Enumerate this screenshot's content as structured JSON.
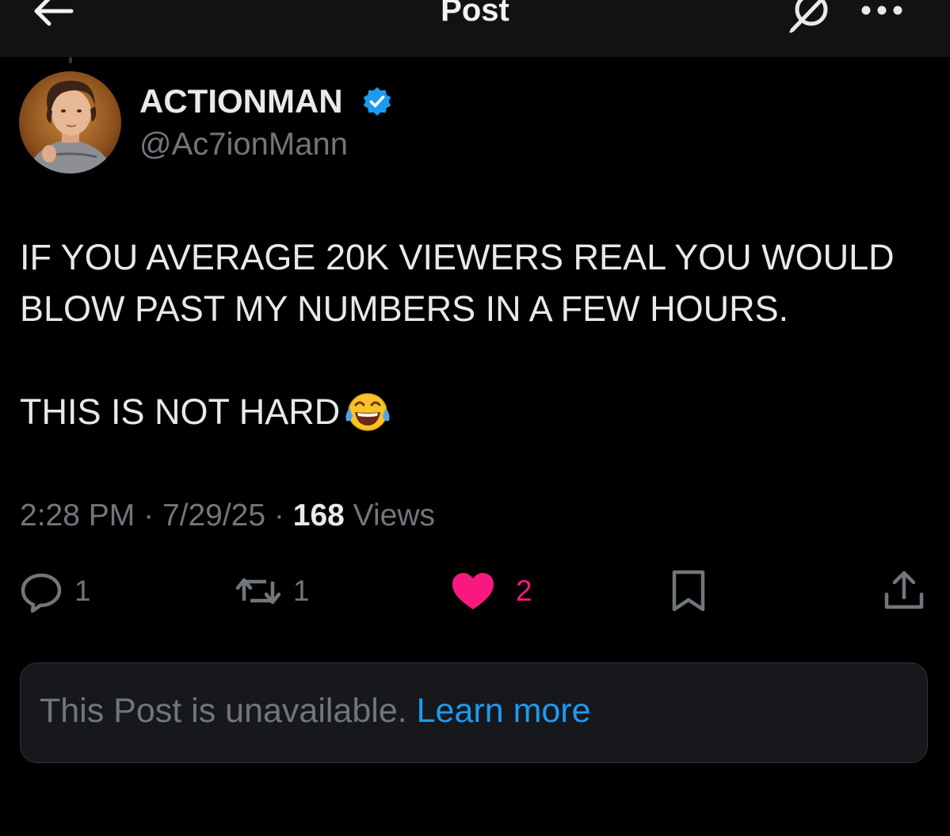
{
  "header": {
    "title": "Post",
    "back_icon": "arrow-left-icon",
    "grok_icon": "grok-icon",
    "more_icon": "more-horizontal-icon"
  },
  "author": {
    "name": "ACTIONMAN",
    "handle": "@Ac7ionMann",
    "verified": true,
    "verified_badge_color": "#1d9bf0"
  },
  "post": {
    "lines": [
      "IF YOU AVERAGE 20K VIEWERS REAL YOU WOULD",
      "BLOW PAST MY NUMBERS IN A FEW HOURS.",
      "",
      "THIS IS NOT HARD"
    ],
    "emoji": "face-with-tears-of-joy"
  },
  "meta": {
    "time": "2:28 PM",
    "separator": "·",
    "date": "7/29/25",
    "views_count": "168",
    "views_label": "Views"
  },
  "actions": {
    "replies": "1",
    "reposts": "1",
    "likes": "2",
    "liked": true,
    "like_color": "#f91880"
  },
  "unavailable": {
    "text": "This Post is unavailable.",
    "link_label": "Learn more",
    "link_color": "#1d9bf0"
  }
}
